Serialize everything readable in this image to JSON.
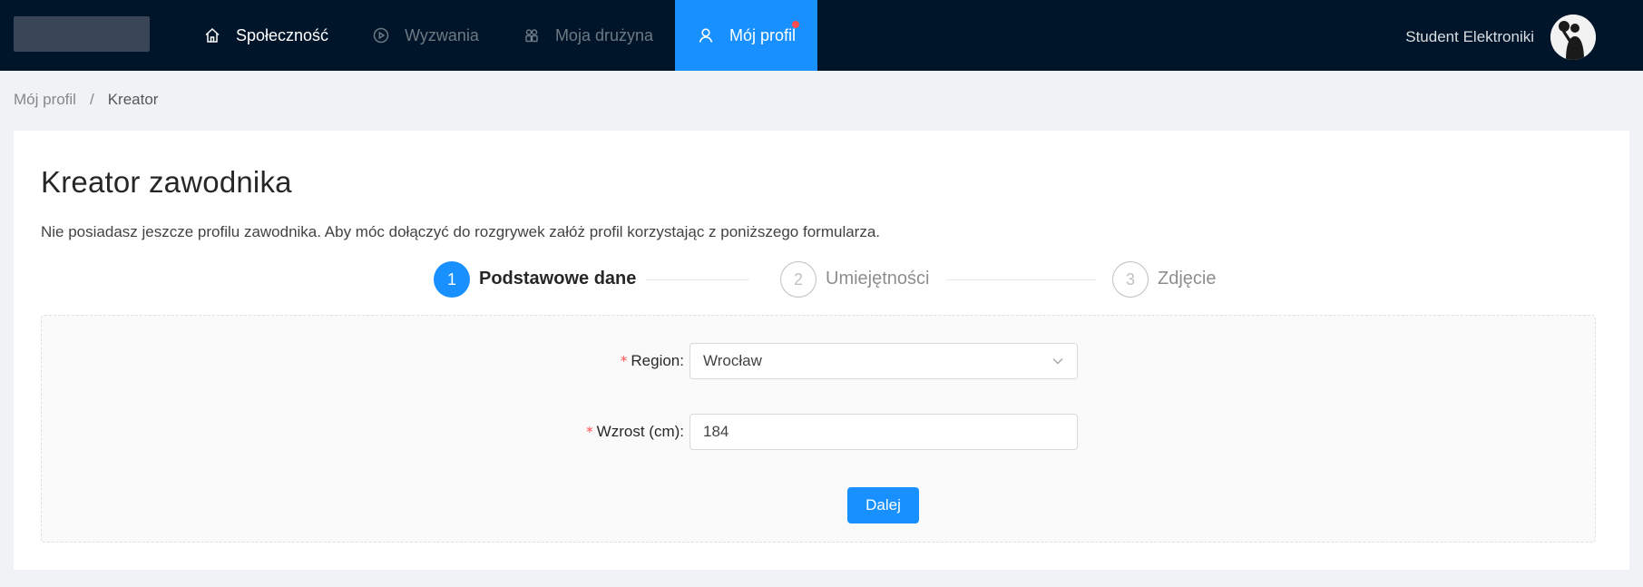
{
  "header": {
    "nav": [
      {
        "label": "Społeczność",
        "icon": "home-icon",
        "state": "normal"
      },
      {
        "label": "Wyzwania",
        "icon": "play-circle-icon",
        "state": "dim"
      },
      {
        "label": "Moja drużyna",
        "icon": "team-icon",
        "state": "dim"
      },
      {
        "label": "Mój profil",
        "icon": "user-icon",
        "state": "selected",
        "badge": "dot"
      }
    ],
    "user_name": "Student Elektroniki",
    "accent": "#1890ff",
    "bg": "#001529"
  },
  "breadcrumb": {
    "items": [
      "Mój profil",
      "Kreator"
    ],
    "separator": "/"
  },
  "page": {
    "title": "Kreator zawodnika",
    "description": "Nie posiadasz jeszcze profilu zawodnika. Aby móc dołączyć do rozgrywek załóż profil korzystając z poniższego formularza."
  },
  "steps": [
    {
      "number": "1",
      "label": "Podstawowe dane",
      "status": "active"
    },
    {
      "number": "2",
      "label": "Umiejętności",
      "status": "wait"
    },
    {
      "number": "3",
      "label": "Zdjęcie",
      "status": "wait"
    }
  ],
  "form": {
    "region": {
      "label": "Region",
      "value": "Wrocław",
      "required": "*"
    },
    "height": {
      "label": "Wzrost (cm)",
      "value": "184",
      "required": "*"
    },
    "submit_label": "Dalej"
  }
}
